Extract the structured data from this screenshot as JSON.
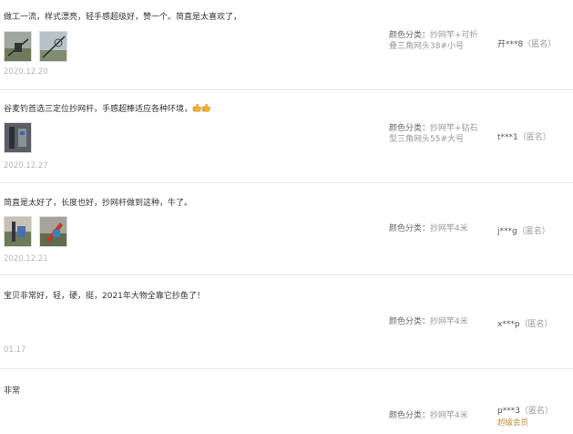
{
  "reviews": [
    {
      "text": "做工一流，样式漂亮，轻手感超级好，赞一个。简直是太喜欢了，",
      "date": "2020.12.20",
      "sku_label": "颜色分类：",
      "sku_line1": "抄网竿+可折",
      "sku_line2": "叠三角网头38#小号",
      "user": "开***8",
      "anon": "（匿名）",
      "thumbs": [
        "photo-thumbnail",
        "photo-thumbnail"
      ]
    },
    {
      "text": "谷麦钓首选三定位抄网杆，手感超棒适应各种环境，",
      "date": "2020.12.27",
      "sku_label": "颜色分类：",
      "sku_line1": "抄网竿+钻石",
      "sku_line2": "型三角网头55#大号",
      "user": "t***1",
      "anon": "（匿名）",
      "thumbs": [
        "photo-thumbnail"
      ]
    },
    {
      "text": "简直是太好了，长度也好，抄网杆做到这种，牛了。",
      "date": "2020.12.21",
      "sku_label": "颜色分类：",
      "sku_line1": "抄网竿4米",
      "user": "j***g",
      "anon": "（匿名）",
      "thumbs": [
        "photo-thumbnail",
        "photo-thumbnail"
      ]
    },
    {
      "text": "宝贝非常好，轻，硬，挺，2021年大物全靠它抄鱼了！",
      "date": "01.17",
      "sku_label": "颜色分类：",
      "sku_line1": "抄网竿4米",
      "user": "x***p",
      "anon": "（匿名）"
    },
    {
      "text": "非常",
      "sku_label": "颜色分类：",
      "sku_line1": "抄网竿4米",
      "user": "p***3",
      "anon": "（匿名）",
      "badge": "超级会员"
    }
  ],
  "colors": {
    "date": "#b5b5b5",
    "vip": "#c68d3b",
    "divider": "#e6e6e6"
  }
}
